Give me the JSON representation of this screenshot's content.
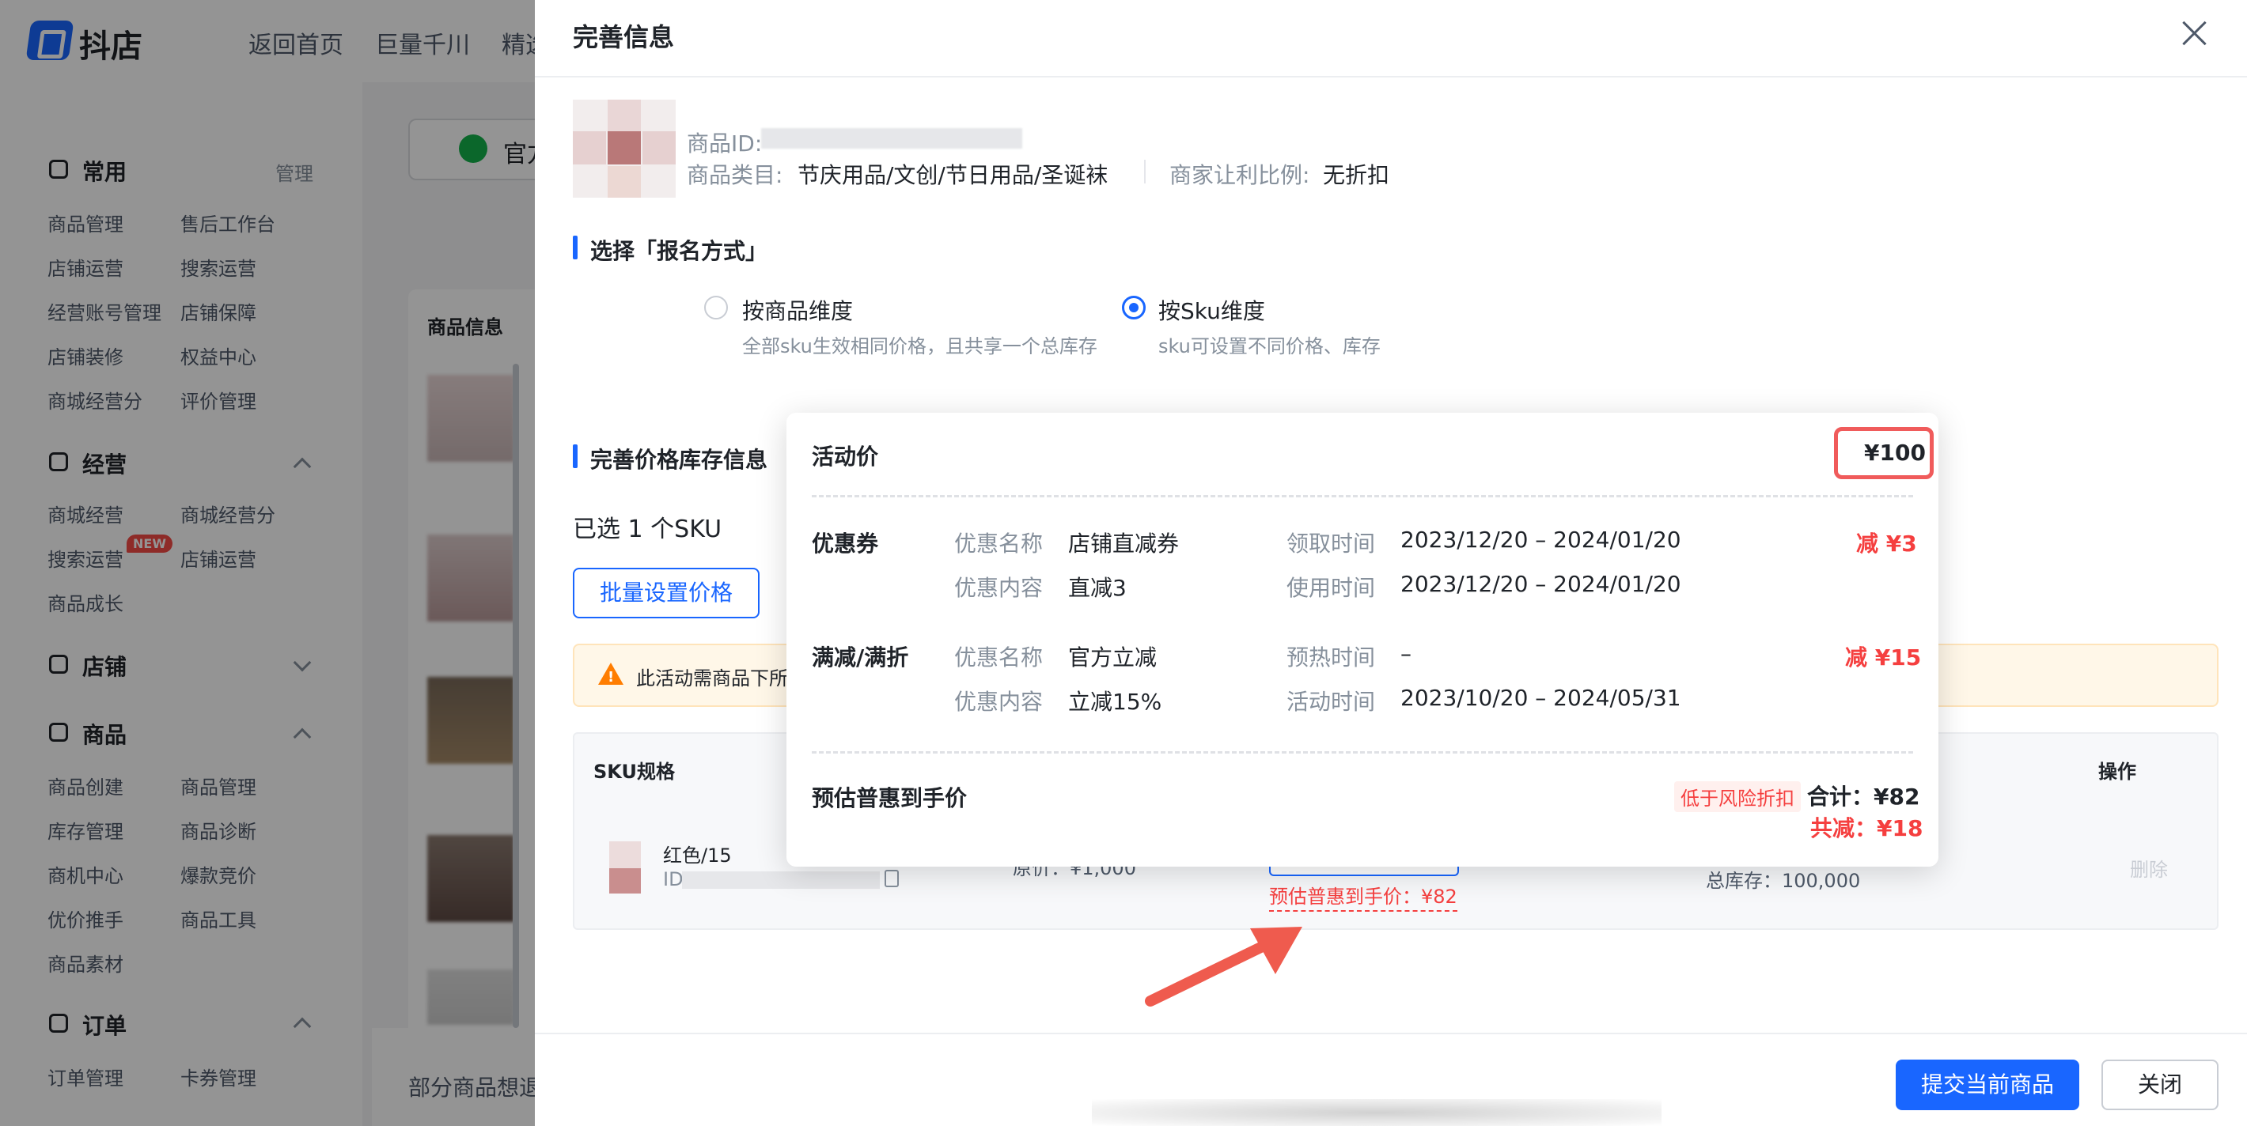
{
  "app": {
    "name": "抖店"
  },
  "top_nav": [
    "返回首页",
    "巨量千川",
    "精选"
  ],
  "sidebar": {
    "sections": [
      {
        "title": "常用",
        "action": "管理",
        "items": [
          "商品管理",
          "售后工作台",
          "店铺运营",
          "搜索运营",
          "经营账号管理",
          "店铺保障",
          "店铺装修",
          "权益中心",
          "商城经营分",
          "评价管理"
        ]
      },
      {
        "title": "经营",
        "items": [
          "商城经营",
          "商城经营分",
          "搜索运营",
          "店铺运营",
          "商品成长"
        ],
        "badge": "NEW"
      },
      {
        "title": "店铺",
        "items": []
      },
      {
        "title": "商品",
        "items": [
          "商品创建",
          "商品管理",
          "库存管理",
          "商品诊断",
          "商机中心",
          "爆款竞价",
          "优价推手",
          "商品工具",
          "商品素材"
        ]
      },
      {
        "title": "订单",
        "items": [
          "订单管理",
          "卡券管理"
        ]
      }
    ]
  },
  "background": {
    "tab_label": "官方",
    "table_header": "商品信息",
    "footer_text": "部分商品想退"
  },
  "modal": {
    "title": "完善信息",
    "product": {
      "id_label": "商品ID:",
      "category_label": "商品类目:",
      "category_value": "节庆用品/文创/节日用品/圣诞袜",
      "discount_label": "商家让利比例:",
      "discount_value": "无折扣"
    },
    "signup_section": {
      "title": "选择「报名方式」",
      "options": [
        {
          "label": "按商品维度",
          "desc": "全部sku生效相同价格，且共享一个总库存",
          "selected": false
        },
        {
          "label": "按Sku维度",
          "desc": "sku可设置不同价格、库存",
          "selected": true
        }
      ]
    },
    "price_section": {
      "title": "完善价格库存信息",
      "selected_count": "已选 1 个SKU",
      "batch_button": "批量设置价格",
      "warning": "此活动需商品下所",
      "table": {
        "col_sku": "SKU规格",
        "col_op": "操作",
        "rows": [
          {
            "name": "红色/15",
            "id_label": "ID",
            "original_price": "原价：¥1,000",
            "estimate": "预估普惠到手价：¥82",
            "stock": "总库存：100,000",
            "delete": "删除"
          }
        ]
      }
    },
    "footer": {
      "submit": "提交当前商品",
      "close": "关闭"
    }
  },
  "popover": {
    "activity_price_label": "活动价",
    "activity_price": "¥100",
    "coupon": {
      "heading": "优惠券",
      "name_label": "优惠名称",
      "name_value": "店铺直减券",
      "content_label": "优惠内容",
      "content_value": "直减3",
      "claim_label": "领取时间",
      "claim_value": "2023/12/20 – 2024/01/20",
      "use_label": "使用时间",
      "use_value": "2023/12/20 – 2024/01/20",
      "reduce": "减 ¥3"
    },
    "full_reduction": {
      "heading": "满减/满折",
      "name_label": "优惠名称",
      "name_value": "官方立减",
      "content_label": "优惠内容",
      "content_value": "立减15%",
      "preheat_label": "预热时间",
      "preheat_value": "–",
      "active_label": "活动时间",
      "active_value": "2023/10/20 – 2024/05/31",
      "reduce": "减 ¥15"
    },
    "estimate": {
      "label": "预估普惠到手价",
      "risk_tag": "低于风险折扣",
      "total": "合计：¥82",
      "saved": "共减：¥18"
    }
  },
  "colors": {
    "primary": "#1966ff",
    "danger": "#f53f3f",
    "highlight_border": "#f05b5b",
    "arrow": "#ef5b4e"
  }
}
